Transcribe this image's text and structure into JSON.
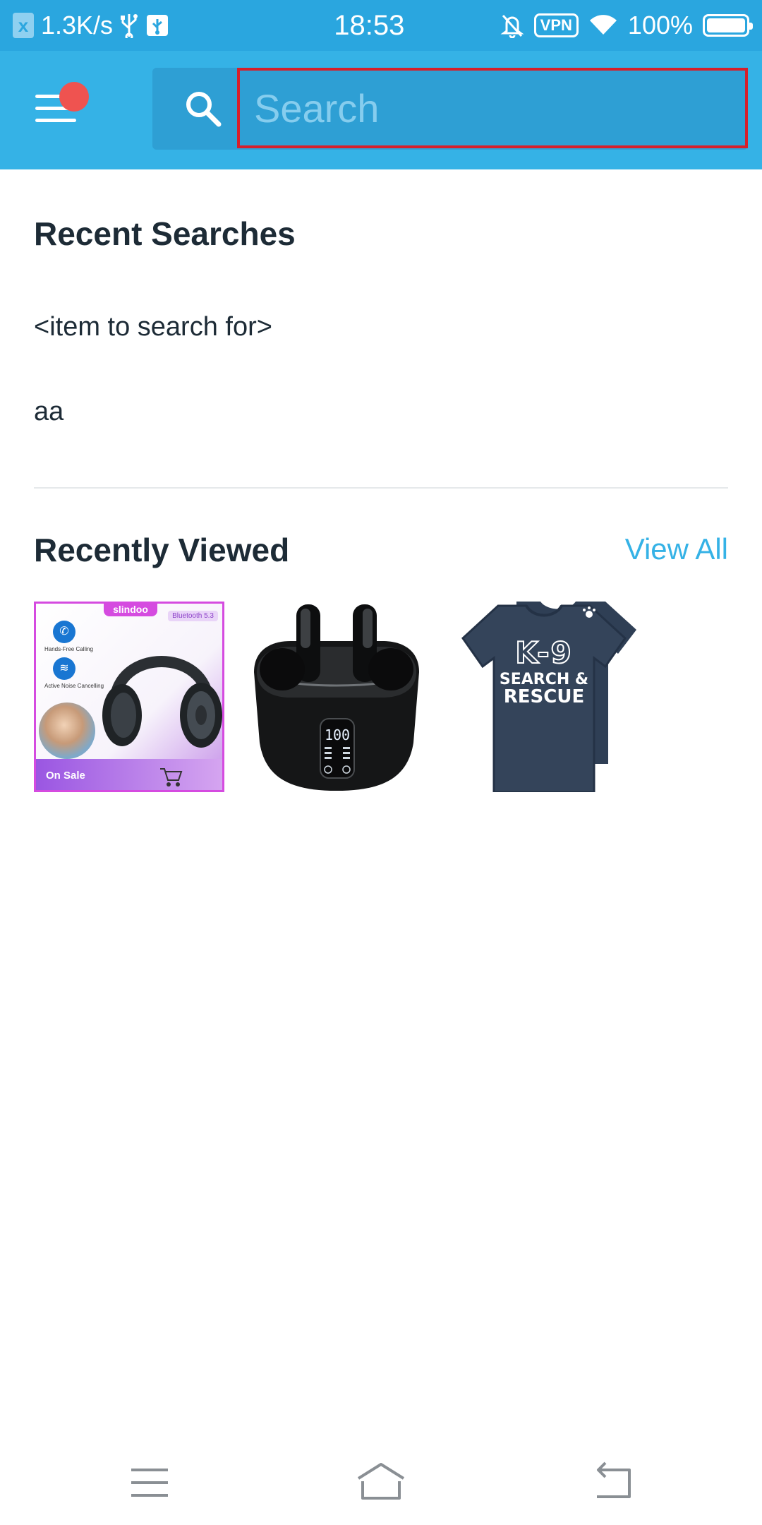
{
  "status_bar": {
    "badge": "x",
    "speed": "1.3K/s",
    "time": "18:53",
    "vpn": "VPN",
    "battery": "100%"
  },
  "header": {
    "search": {
      "placeholder": "Search",
      "value": ""
    },
    "colors": {
      "accent": "#35b2e6",
      "status": "#2aa6df",
      "highlight": "#d61f2b",
      "notification_dot": "#ef5350"
    }
  },
  "recent_searches": {
    "title": "Recent Searches",
    "items": [
      "<item to search for>",
      "aa"
    ]
  },
  "recently_viewed": {
    "title": "Recently Viewed",
    "view_all": "View All",
    "thumb1": {
      "brand": "slindoo",
      "bluetooth": "Bluetooth 5.3",
      "feature1": "Hands-Free Calling",
      "feature2": "Active Noise Cancelling",
      "on_sale": "On Sale"
    },
    "thumb3": {
      "line1": "K-9",
      "line2": "SEARCH &",
      "line3": "RESCUE"
    }
  },
  "nav_bar": {
    "icons": [
      "menu-icon",
      "home-icon",
      "back-icon"
    ]
  }
}
